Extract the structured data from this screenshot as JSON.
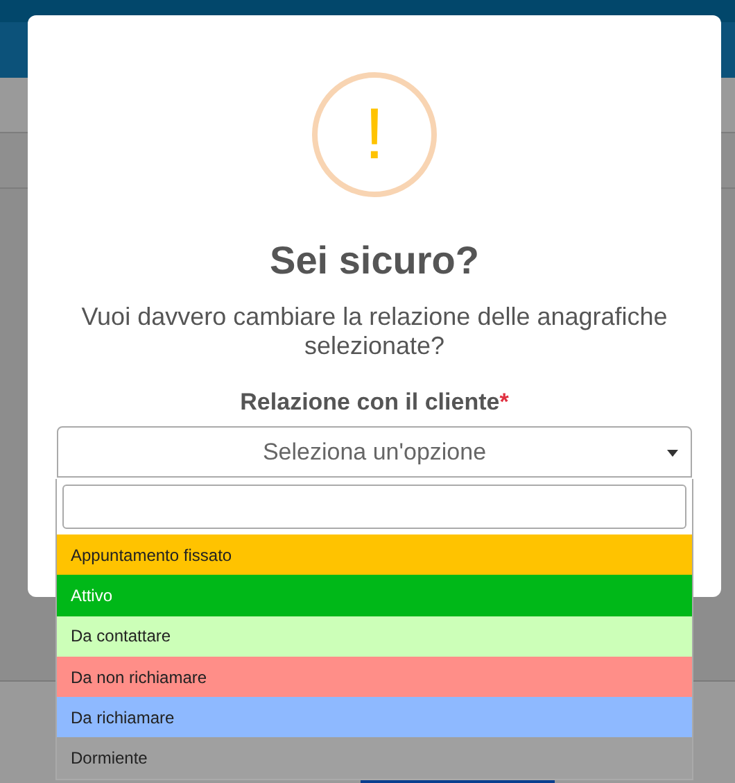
{
  "dialog": {
    "icon": "!",
    "title": "Sei sicuro?",
    "message": "Vuoi davvero cambiare la relazione delle anagrafiche selezionate?",
    "field_label": "Relazione con il cliente",
    "required_mark": "*",
    "select": {
      "placeholder": "Seleziona un'opzione",
      "expanded": true
    }
  },
  "dropdown": {
    "options": [
      {
        "label": "Appuntamento fissato",
        "color": "#ffc300"
      },
      {
        "label": "Attivo",
        "color": "#00b818"
      },
      {
        "label": "Da contattare",
        "color": "#ccffb8"
      },
      {
        "label": "Da non richiamare",
        "color": "#ff8e88"
      },
      {
        "label": "Da richiamare",
        "color": "#8eb9ff"
      },
      {
        "label": "Dormiente",
        "color": "#a0a0a0"
      }
    ]
  }
}
